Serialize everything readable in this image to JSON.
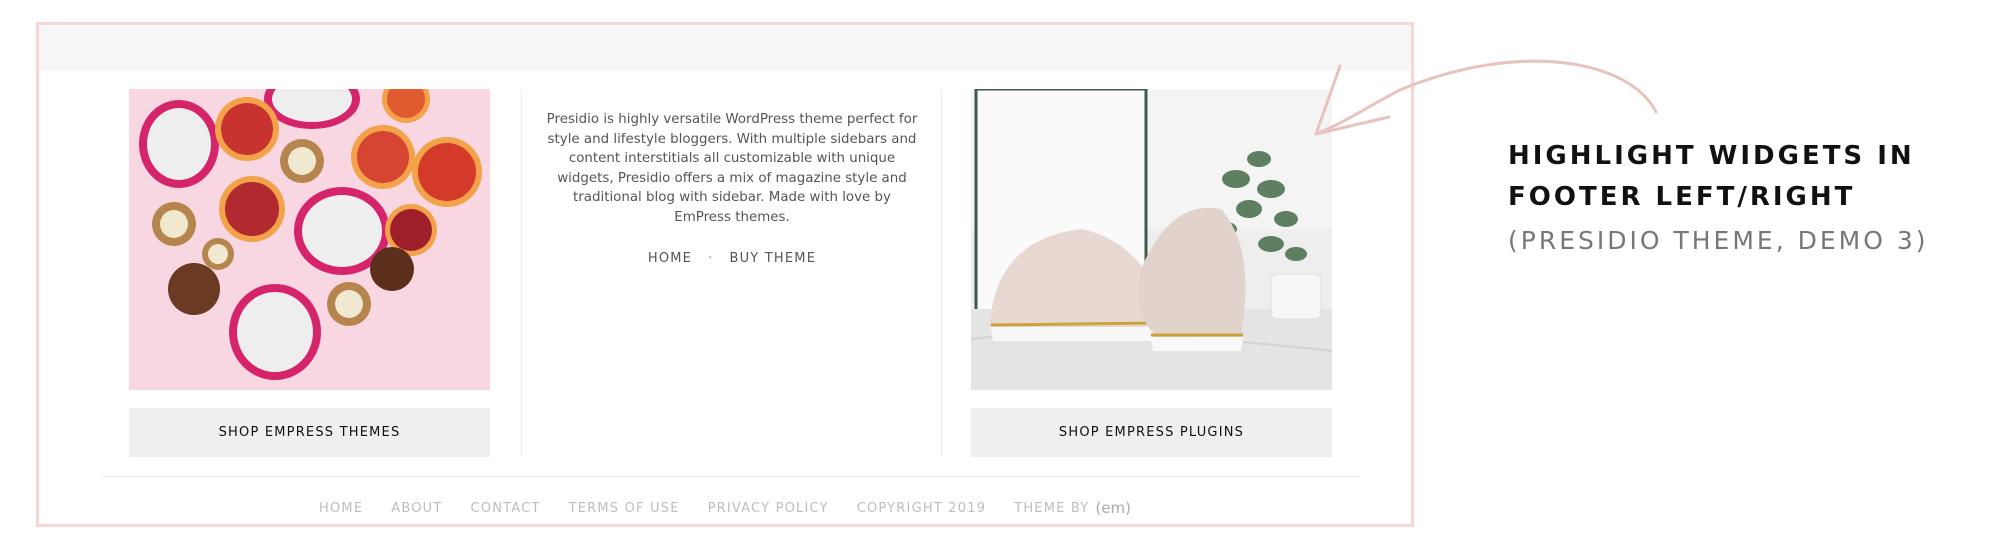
{
  "footer_widgets": {
    "left": {
      "button_label": "SHOP EMPRESS THEMES"
    },
    "center": {
      "description": "Presidio is highly versatile WordPress theme perfect for style and lifestyle bloggers. With multiple sidebars and content interstitials all customizable with unique widgets, Presidio offers a mix of magazine style and traditional blog with sidebar. Made with love by EmPress themes.",
      "links": [
        {
          "label": "HOME"
        },
        {
          "label": "BUY THEME"
        }
      ],
      "separator": "·"
    },
    "right": {
      "button_label": "SHOP EMPRESS PLUGINS"
    }
  },
  "footer_nav": {
    "links": [
      {
        "label": "HOME"
      },
      {
        "label": "ABOUT"
      },
      {
        "label": "CONTACT"
      },
      {
        "label": "TERMS OF USE"
      },
      {
        "label": "PRIVACY POLICY"
      }
    ],
    "copyright": "COPYRIGHT 2019",
    "credit_prefix": "THEME BY",
    "credit_logo": "(em)"
  },
  "annotation": {
    "heading_line1": "HIGHLIGHT WIDGETS IN",
    "heading_line2": "FOOTER LEFT/RIGHT",
    "subheading": "(PRESIDIO THEME, DEMO 3)"
  },
  "colors": {
    "frame_border": "#f5d7d5",
    "arrow": "#e8c2bd",
    "top_bar": "#f7f7f7",
    "button_bg": "#efefef",
    "footer_text": "#bdbdbd"
  }
}
